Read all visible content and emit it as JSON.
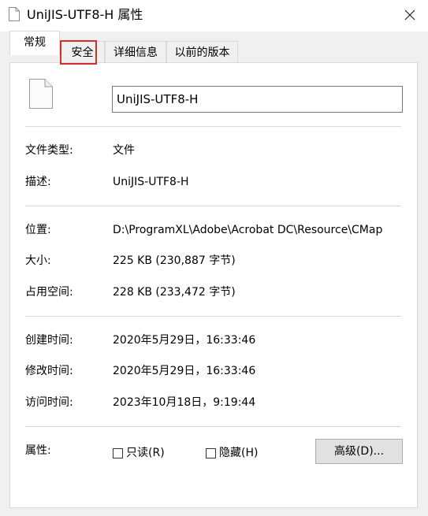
{
  "window": {
    "title": "UniJIS-UTF8-H 属性",
    "close_icon": "close-icon"
  },
  "tabs": [
    {
      "label": "常规",
      "active": true
    },
    {
      "label": "安全",
      "highlighted": true
    },
    {
      "label": "详细信息"
    },
    {
      "label": "以前的版本"
    }
  ],
  "general": {
    "file_name": "UniJIS-UTF8-H",
    "file_type_label": "文件类型:",
    "file_type_value": "文件",
    "description_label": "描述:",
    "description_value": "UniJIS-UTF8-H",
    "location_label": "位置:",
    "location_value": "D:\\ProgramXL\\Adobe\\Acrobat DC\\Resource\\CMap",
    "size_label": "大小:",
    "size_value": "225 KB (230,887 字节)",
    "size_on_disk_label": "占用空间:",
    "size_on_disk_value": "228 KB (233,472 字节)",
    "created_label": "创建时间:",
    "created_value": "2020年5月29日，16:33:46",
    "modified_label": "修改时间:",
    "modified_value": "2020年5月29日，16:33:46",
    "accessed_label": "访问时间:",
    "accessed_value": "2023年10月18日，9:19:44",
    "attributes_label": "属性:",
    "readonly_label": "只读(R)",
    "hidden_label": "隐藏(H)",
    "advanced_button": "高级(D)..."
  }
}
